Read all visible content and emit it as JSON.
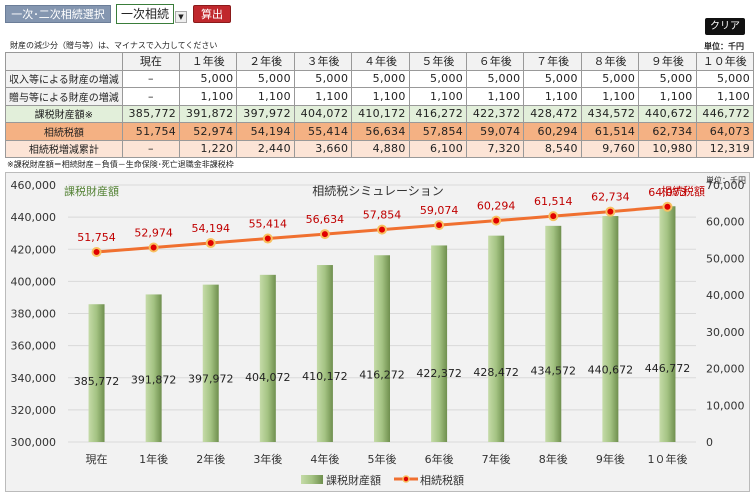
{
  "header": {
    "selector_label": "一次･二次相続選択",
    "selector_value": "一次相続",
    "calc_button": "算出",
    "clear_button": "クリア"
  },
  "note": "財産の減少分（贈与等）は、マイナスで入力してください",
  "unit": "単位：千円",
  "table": {
    "columns": [
      "",
      "現在",
      "１年後",
      "２年後",
      "３年後",
      "４年後",
      "５年後",
      "６年後",
      "７年後",
      "８年後",
      "９年後",
      "１０年後"
    ],
    "rows": [
      {
        "label": "収入等による財産の増減",
        "values": [
          "–",
          "5,000",
          "5,000",
          "5,000",
          "5,000",
          "5,000",
          "5,000",
          "5,000",
          "5,000",
          "5,000",
          "5,000"
        ]
      },
      {
        "label": "贈与等による財産の増減",
        "values": [
          "–",
          "1,100",
          "1,100",
          "1,100",
          "1,100",
          "1,100",
          "1,100",
          "1,100",
          "1,100",
          "1,100",
          "1,100"
        ]
      },
      {
        "label": "課税財産額※",
        "values": [
          "385,772",
          "391,872",
          "397,972",
          "404,072",
          "410,172",
          "416,272",
          "422,372",
          "428,472",
          "434,572",
          "440,672",
          "446,772"
        ]
      },
      {
        "label": "相続税額",
        "values": [
          "51,754",
          "52,974",
          "54,194",
          "55,414",
          "56,634",
          "57,854",
          "59,074",
          "60,294",
          "61,514",
          "62,734",
          "64,073"
        ]
      },
      {
        "label": "相続税増減累計",
        "values": [
          "–",
          "1,220",
          "2,440",
          "3,660",
          "4,880",
          "6,100",
          "7,320",
          "8,540",
          "9,760",
          "10,980",
          "12,319"
        ]
      }
    ]
  },
  "footnote": "※課税財産額＝相続財産－負債－生命保険･死亡退職金非課税枠",
  "chart_data": {
    "type": "bar",
    "title": "相続税シミュレーション",
    "unit": "単位：千円",
    "left_axis_title": "課税財産額",
    "right_axis_title": "相続税額",
    "categories": [
      "現在",
      "1年後",
      "2年後",
      "3年後",
      "4年後",
      "5年後",
      "6年後",
      "7年後",
      "8年後",
      "9年後",
      "1０年後"
    ],
    "left_ylim": [
      300000,
      460000
    ],
    "left_ticks": [
      "300,000",
      "320,000",
      "340,000",
      "360,000",
      "380,000",
      "400,000",
      "420,000",
      "440,000",
      "460,000"
    ],
    "right_ylim": [
      0,
      70000
    ],
    "right_ticks": [
      "0",
      "10,000",
      "20,000",
      "30,000",
      "40,000",
      "50,000",
      "60,000",
      "70,000"
    ],
    "grid": true,
    "legend": "bottom",
    "series": [
      {
        "name": "課税財産額",
        "type": "bar",
        "axis": "left",
        "color": "#9bbb59",
        "values": [
          385772,
          391872,
          397972,
          404072,
          410172,
          416272,
          422372,
          428472,
          434572,
          440672,
          446772
        ],
        "labels": [
          "385,772",
          "391,872",
          "397,972",
          "404,072",
          "410,172",
          "416,272",
          "422,372",
          "428,472",
          "434,572",
          "440,672",
          "446,772"
        ]
      },
      {
        "name": "相続税額",
        "type": "line",
        "axis": "right",
        "color": "#f07030",
        "values": [
          51754,
          52974,
          54194,
          55414,
          56634,
          57854,
          59074,
          60294,
          61514,
          62734,
          64073
        ],
        "labels": [
          "51,754",
          "52,974",
          "54,194",
          "55,414",
          "56,634",
          "57,854",
          "59,074",
          "60,294",
          "61,514",
          "62,734",
          "64,073"
        ]
      }
    ]
  }
}
